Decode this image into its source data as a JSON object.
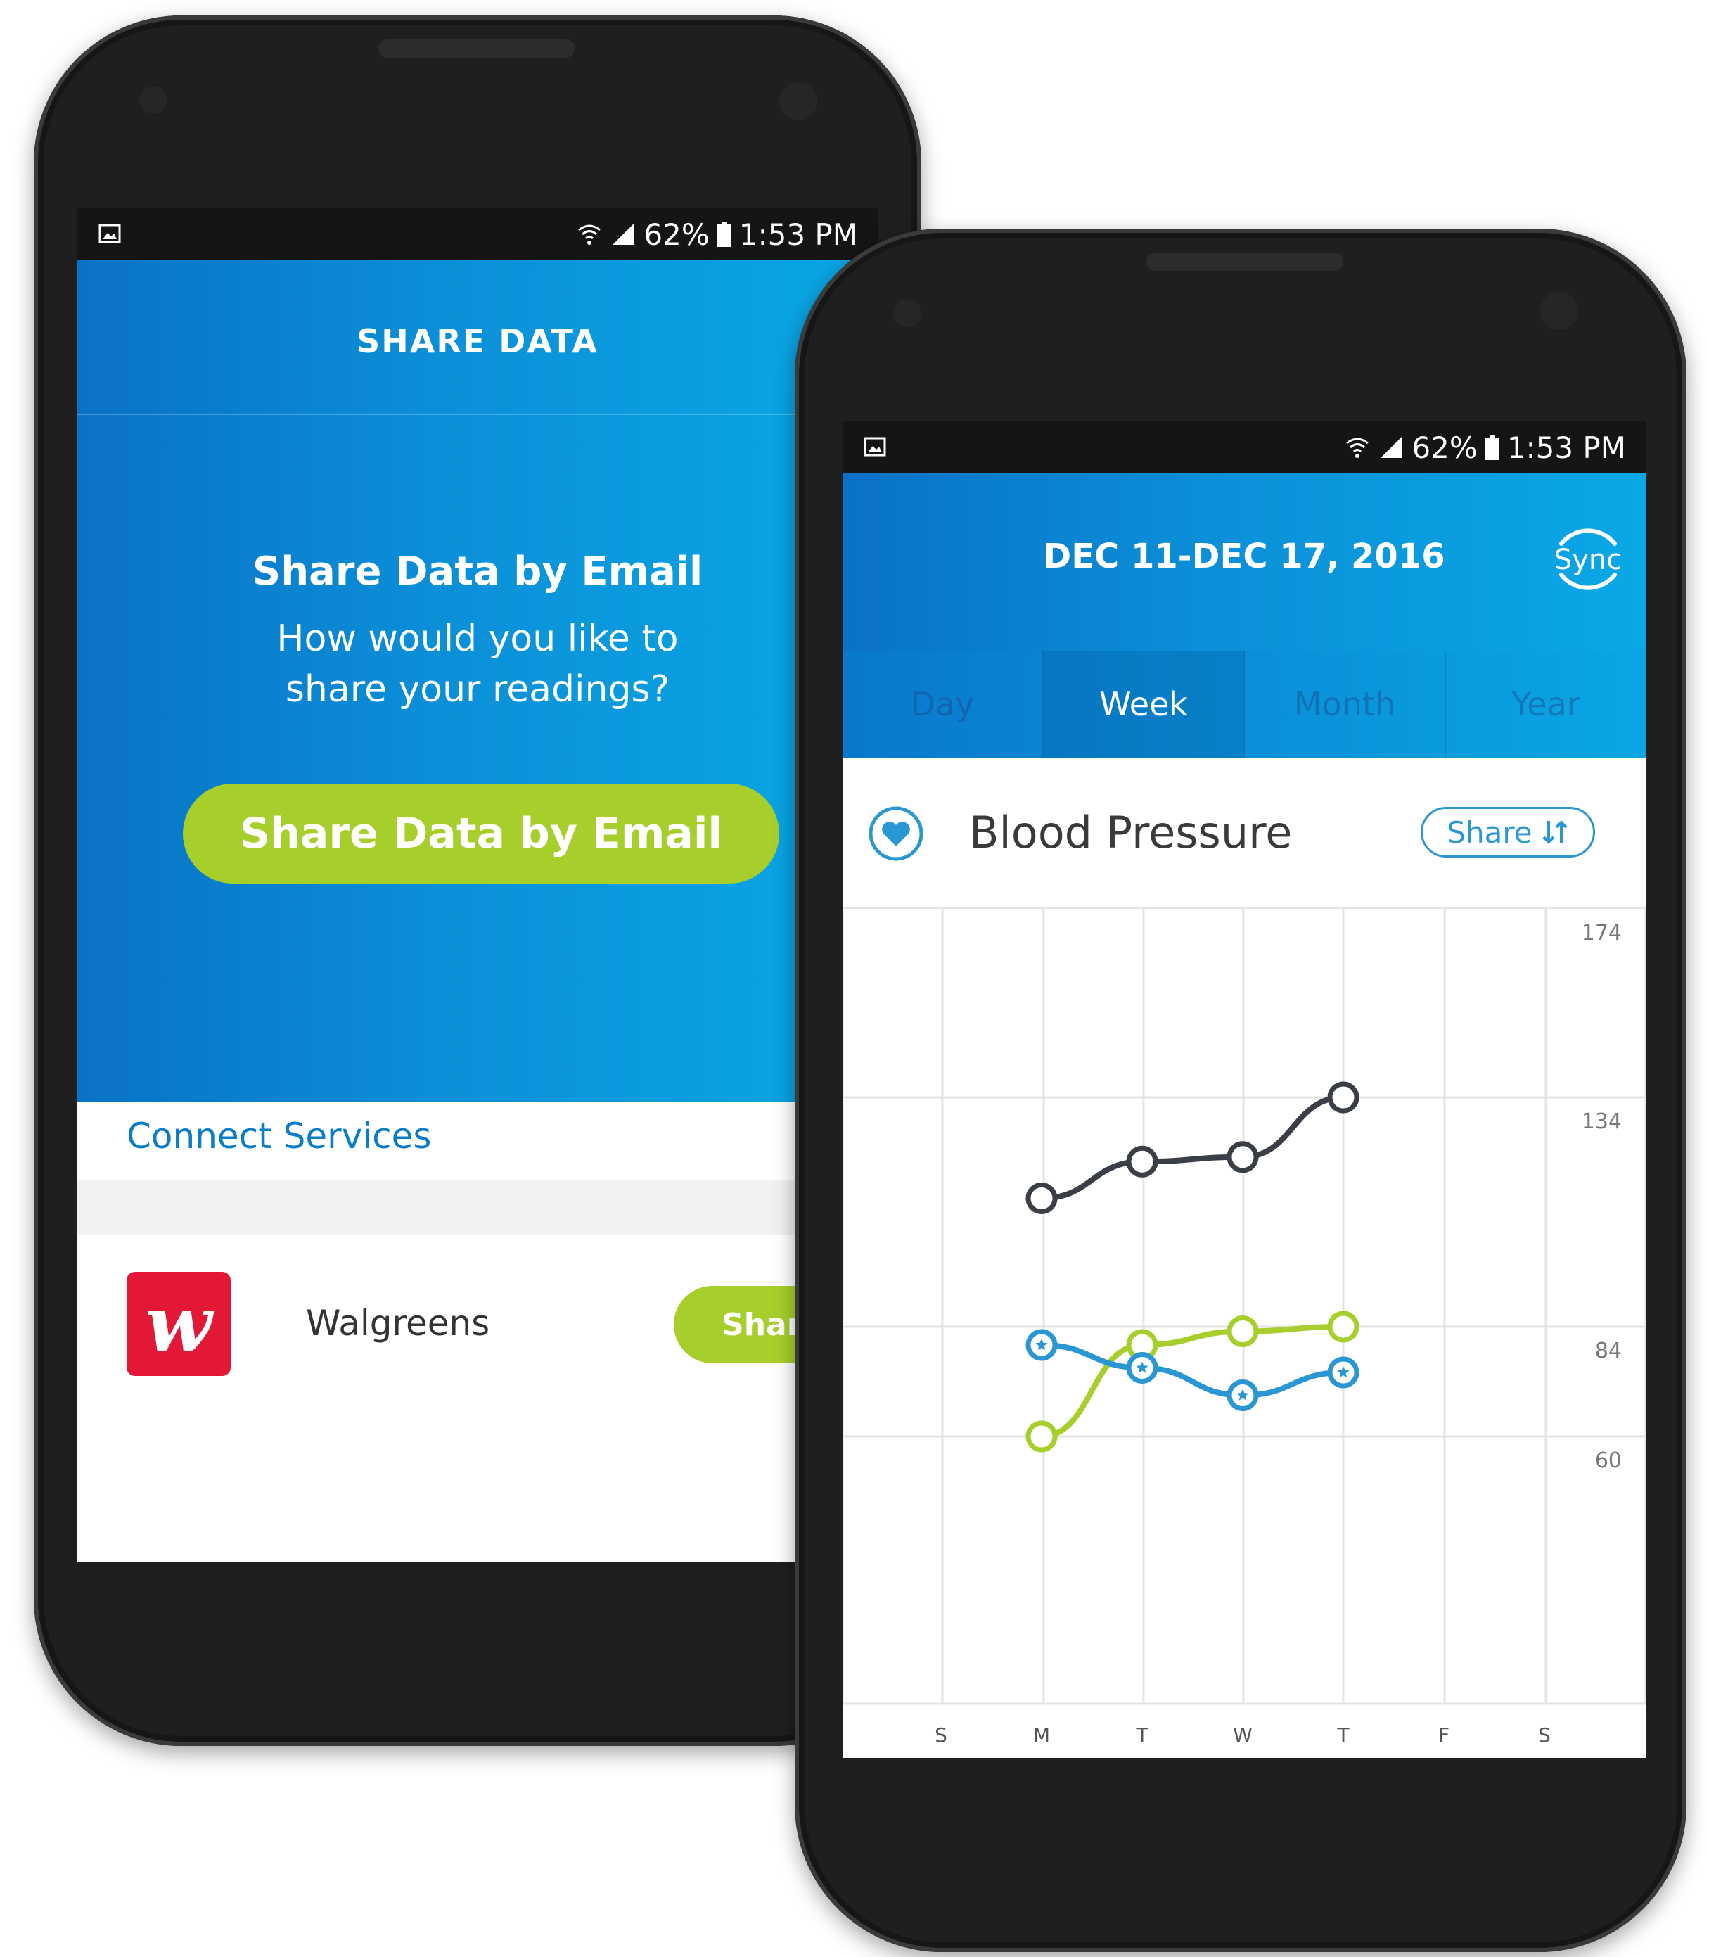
{
  "left_phone": {
    "status": {
      "battery": "62%",
      "time": "1:53 PM"
    },
    "header_title": "SHARE DATA",
    "share_section": {
      "heading": "Share Data by Email",
      "prompt_line1": "How would you like to",
      "prompt_line2": "share your readings?",
      "button_label": "Share Data by Email"
    },
    "connect_services_label": "Connect Services",
    "service": {
      "name": "Walgreens",
      "logo_letter": "w",
      "button_label": "Share"
    }
  },
  "right_phone": {
    "status": {
      "battery": "62%",
      "time": "1:53 PM"
    },
    "date_range": "DEC 11-DEC 17, 2016",
    "sync_label": "Sync",
    "tabs": [
      {
        "label": "Day",
        "active": false
      },
      {
        "label": "Week",
        "active": true
      },
      {
        "label": "Month",
        "active": false
      },
      {
        "label": "Year",
        "active": false
      }
    ],
    "metric_title": "Blood Pressure",
    "share_label": "Share",
    "share_icon": "sort-arrows-icon"
  },
  "colors": {
    "brand_blue": "#0a8fd8",
    "accent_green": "#a6cf2c",
    "walgreens_red": "#e31837",
    "systolic_line": "#3a3f47",
    "diastolic_line": "#a6cf2c",
    "pulse_line": "#2a97d4"
  },
  "chart_data": {
    "type": "line",
    "categories": [
      "S",
      "M",
      "T",
      "W",
      "T",
      "F",
      "S"
    ],
    "y_ticks": [
      174,
      134,
      84,
      60
    ],
    "series": [
      {
        "values": [
          null,
          112,
          120,
          121,
          134,
          null,
          null
        ],
        "color": "#3a3f47",
        "marker": "circle"
      },
      {
        "values": [
          null,
          60,
          80,
          83,
          84,
          null,
          null
        ],
        "color": "#a6cf2c",
        "marker": "circle"
      },
      {
        "values": [
          null,
          80,
          75,
          69,
          74,
          null,
          null
        ],
        "color": "#2a97d4",
        "marker": "star-circle"
      }
    ],
    "grid": true
  }
}
